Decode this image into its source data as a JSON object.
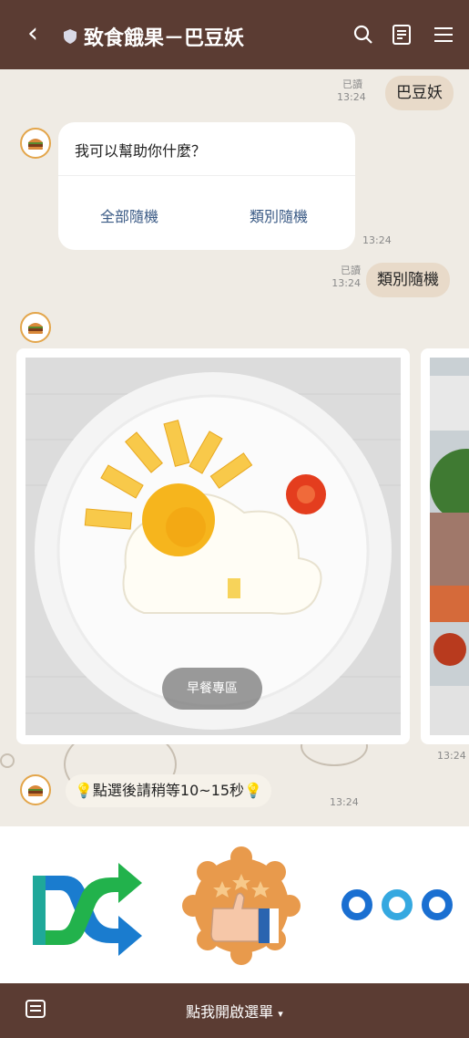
{
  "header": {
    "back_icon": "chevron-left-icon",
    "title": "致食餓果－巴豆妖",
    "icons": [
      "search-icon",
      "notes-icon",
      "menu-icon"
    ]
  },
  "messages": {
    "user1": {
      "text": "巴豆妖",
      "read": "已讀",
      "time": "13:24"
    },
    "bot_card": {
      "question": "我可以幫助你什麼？",
      "option1": "全部隨機",
      "option2": "類別隨機",
      "time": "13:24"
    },
    "user2": {
      "text": "類別隨機",
      "read": "已讀",
      "time": "13:24"
    },
    "carousel": {
      "card1_label": "早餐專區",
      "time": "13:24"
    },
    "bot_notice": {
      "text": "點選後請稍等10~15秒",
      "time": "13:24"
    }
  },
  "rich_menu": {
    "items": [
      "shuffle-icon",
      "thumbs-up-badge-icon",
      "more-dots-icon"
    ],
    "colors": {
      "shuffle_green": "#22b24c",
      "shuffle_blue": "#1a7ccf",
      "badge": "#e89a4c",
      "dots": "#1a6fd1",
      "dots_light": "#35a8e0"
    }
  },
  "bottom_bar": {
    "label": "點我開啟選單",
    "caret": "▾",
    "keyboard_icon": "keyboard-icon"
  },
  "colors": {
    "header_bg": "#5b3c33",
    "chat_bg": "#efebe4",
    "bubble_user": "#e8dac9",
    "option_text": "#3a5a85"
  }
}
